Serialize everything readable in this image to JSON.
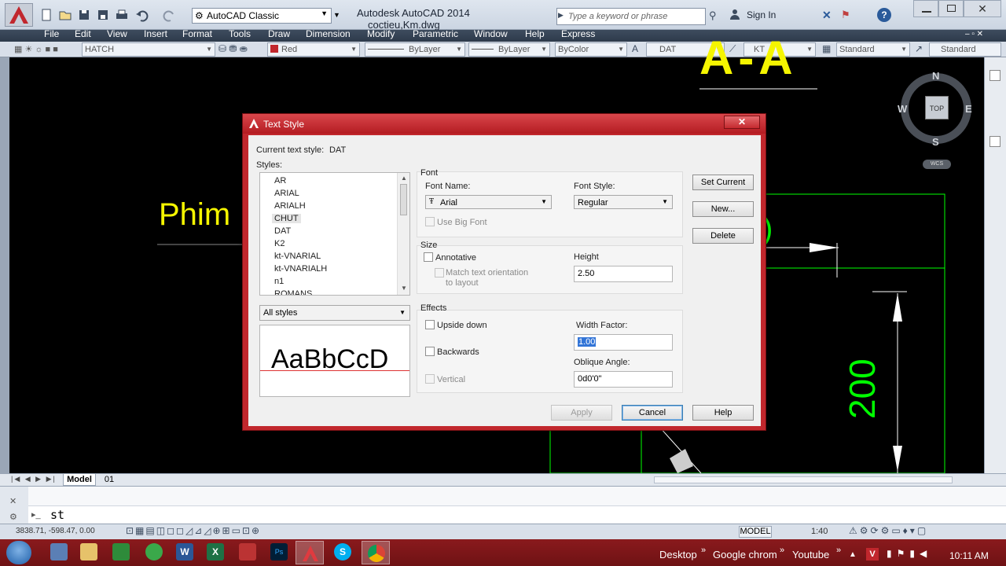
{
  "window": {
    "workspace": "AutoCAD Classic",
    "title_app": "Autodesk AutoCAD 2014",
    "title_file": "coctieu,Km.dwg",
    "search_placeholder": "Type a keyword or phrase",
    "signin": "Sign In"
  },
  "menu": [
    "File",
    "Edit",
    "View",
    "Insert",
    "Format",
    "Tools",
    "Draw",
    "Dimension",
    "Modify",
    "Parametric",
    "Window",
    "Help",
    "Express"
  ],
  "properties_toolbar": {
    "layer": "HATCH",
    "color": "Red",
    "linetype": "ByLayer",
    "lineweight": "ByLayer",
    "plotstyle": "ByColor",
    "text_style": "DAT",
    "dim_style": "KT",
    "table_style": "Standard",
    "mleader_style": "Standard"
  },
  "drawing": {
    "text_phim": "Phim",
    "dim_200": "200",
    "text_top": "A-A",
    "viewcube": {
      "n": "N",
      "s": "S",
      "e": "E",
      "w": "W",
      "top": "TOP",
      "wcs": "WCS"
    }
  },
  "dialog": {
    "title": "Text Style",
    "current_style_label": "Current text style:",
    "current_style_value": "DAT",
    "styles_label": "Styles:",
    "styles": [
      "AR",
      "ARIAL",
      "ARIALH",
      "CHUT",
      "DAT",
      "K2",
      "kt-VNARIAL",
      "kt-VNARIALH",
      "n1",
      "ROMANS"
    ],
    "selected_style": "CHUT",
    "filter": "All styles",
    "preview_text": "AaBbCcD",
    "font_group": "Font",
    "font_name_label": "Font Name:",
    "font_name": "Arial",
    "font_style_label": "Font Style:",
    "font_style": "Regular",
    "use_big_font": "Use Big Font",
    "size_group": "Size",
    "annotative": "Annotative",
    "match_orientation_1": "Match text orientation",
    "match_orientation_2": "to layout",
    "height_label": "Height",
    "height": "2.50",
    "effects_group": "Effects",
    "upside_down": "Upside down",
    "backwards": "Backwards",
    "vertical": "Vertical",
    "width_factor_label": "Width Factor:",
    "width_factor": "1.00",
    "oblique_label": "Oblique Angle:",
    "oblique": "0d0'0\"",
    "buttons": {
      "set_current": "Set Current",
      "new": "New...",
      "delete": "Delete",
      "apply": "Apply",
      "cancel": "Cancel",
      "help": "Help"
    }
  },
  "tabs": {
    "model": "Model",
    "layout": "01"
  },
  "command": {
    "text": "st"
  },
  "status": {
    "coords": "3838.71, -598.47, 0.00",
    "model": "MODEL",
    "scale": "1:40"
  },
  "taskbar": {
    "desktop": "Desktop",
    "chrome": "Google chrom",
    "youtube": "Youtube",
    "clock": "10:11 AM"
  },
  "colors": {
    "accent_red": "#c1272d",
    "drawing_yellow": "#f5f500",
    "drawing_green": "#00ff00"
  }
}
